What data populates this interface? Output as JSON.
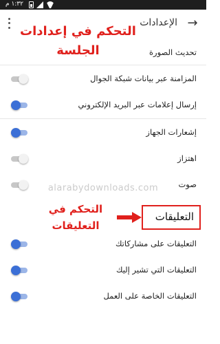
{
  "status_bar": {
    "time": "١:٣٢ م"
  },
  "toolbar": {
    "title": "الإعدادات",
    "back_icon": "arrow-right-icon",
    "menu_icon": "more-vert-icon"
  },
  "annotations": {
    "session_settings": "التحكم في إعدادات الجلسة",
    "comments_control": "التحكم في التعليقات",
    "watermark": "alarabydownloads.com"
  },
  "settings": {
    "refresh_image": "تحديث الصورة",
    "items": [
      {
        "label": "المزامنة عبر بيانات شبكة الجوال",
        "enabled": false
      },
      {
        "label": "إرسال إعلامات عبر البريد الإلكتروني",
        "enabled": true
      },
      {
        "label": "إشعارات الجهاز",
        "enabled": true
      },
      {
        "label": "اهتزاز",
        "enabled": false
      },
      {
        "label": "صوت",
        "enabled": false
      }
    ]
  },
  "comments": {
    "header": "التعليقات",
    "items": [
      {
        "label": "التعليقات على مشاركاتك",
        "enabled": true
      },
      {
        "label": "التعليقات التي تشير إليك",
        "enabled": true
      },
      {
        "label": "التعليقات الخاصة على العمل",
        "enabled": true
      }
    ]
  },
  "colors": {
    "accent": "#3b6fd6",
    "annotation_red": "#e0201c"
  }
}
